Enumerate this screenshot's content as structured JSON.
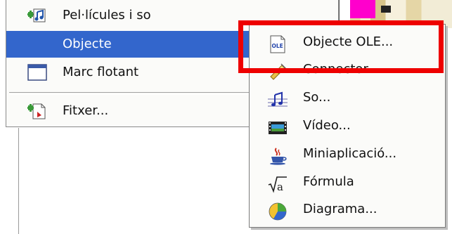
{
  "main_menu": {
    "items": [
      {
        "id": "films",
        "label": "Pel·lícules i so",
        "icon": "film-sound-icon",
        "selected": false
      },
      {
        "id": "object",
        "label": "Objecte",
        "icon": "",
        "selected": true
      },
      {
        "id": "frame",
        "label": "Marc flotant",
        "icon": "floating-frame-icon",
        "selected": false
      },
      {
        "id": "file",
        "label": "Fitxer...",
        "icon": "insert-file-icon",
        "selected": false
      }
    ]
  },
  "submenu": {
    "items": [
      {
        "id": "ole",
        "label": "Objecte OLE...",
        "icon": "ole-object-icon"
      },
      {
        "id": "connector",
        "label": "Connector",
        "icon": "plugin-connector-icon"
      },
      {
        "id": "sound",
        "label": "So...",
        "icon": "music-note-icon"
      },
      {
        "id": "video",
        "label": "Vídeo...",
        "icon": "film-strip-icon"
      },
      {
        "id": "applet",
        "label": "Miniaplicació...",
        "icon": "java-applet-icon"
      },
      {
        "id": "formula",
        "label": "Fórmula",
        "icon": "formula-icon"
      },
      {
        "id": "chart",
        "label": "Diagrama...",
        "icon": "pie-chart-icon"
      }
    ]
  },
  "colors": {
    "selection": "#3366cc",
    "highlight_box": "#ee0000",
    "menu_background": "#fbfbf9"
  }
}
